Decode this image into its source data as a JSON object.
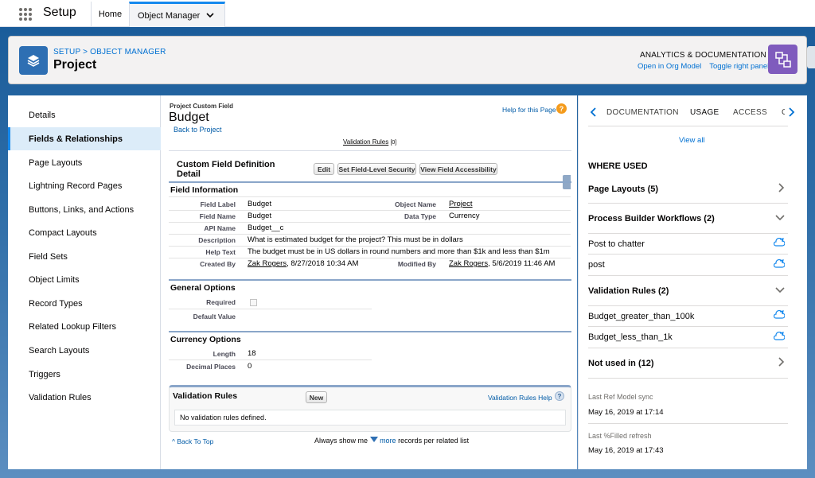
{
  "topbar": {
    "app_name": "Setup",
    "tab_home": "Home",
    "tab_object_manager": "Object Manager"
  },
  "header": {
    "breadcrumb_setup": "SETUP",
    "breadcrumb_sep": " > ",
    "breadcrumb_om": "OBJECT MANAGER",
    "title": "Project",
    "analytics_title": "ANALYTICS & DOCUMENTATION",
    "link_org_model": "Open in Org Model",
    "link_toggle": "Toggle right panel"
  },
  "sidebar": {
    "items": [
      {
        "label": "Details"
      },
      {
        "label": "Fields & Relationships"
      },
      {
        "label": "Page Layouts"
      },
      {
        "label": "Lightning Record Pages"
      },
      {
        "label": "Buttons, Links, and Actions"
      },
      {
        "label": "Compact Layouts"
      },
      {
        "label": "Field Sets"
      },
      {
        "label": "Object Limits"
      },
      {
        "label": "Record Types"
      },
      {
        "label": "Related Lookup Filters"
      },
      {
        "label": "Search Layouts"
      },
      {
        "label": "Triggers"
      },
      {
        "label": "Validation Rules"
      }
    ]
  },
  "main": {
    "subtitle": "Project Custom Field",
    "title": "Budget",
    "back_link": "Back to Project",
    "help_link": "Help for this Page",
    "validation_rules_link": "Validation Rules",
    "validation_rules_count": "[0]",
    "detail_title_1": "Custom Field Definition",
    "detail_title_2": "Detail",
    "btn_edit": "Edit",
    "btn_fls": "Set Field-Level Security",
    "btn_view_access": "View Field Accessibility",
    "field_info_title": "Field Information",
    "fields": {
      "field_label_l": "Field Label",
      "field_label_v": "Budget",
      "object_name_l": "Object Name",
      "object_name_v": "Project",
      "field_name_l": "Field Name",
      "field_name_v": "Budget",
      "data_type_l": "Data Type",
      "data_type_v": "Currency",
      "api_name_l": "API Name",
      "api_name_v": "Budget__c",
      "description_l": "Description",
      "description_v": "What is estimated budget for the project? This must be in dollars",
      "help_text_l": "Help Text",
      "help_text_v": "The budget must be in US dollars in round numbers and more than $1k and less than $1m",
      "created_by_l": "Created By",
      "created_by_user": "Zak Rogers",
      "created_by_date": ", 8/27/2018 10:34 AM",
      "modified_by_l": "Modified By",
      "modified_by_user": "Zak Rogers",
      "modified_by_date": ", 5/6/2019 11:46 AM"
    },
    "general_title": "General Options",
    "required_l": "Required",
    "default_value_l": "Default Value",
    "currency_title": "Currency Options",
    "length_l": "Length",
    "length_v": "18",
    "decimal_l": "Decimal Places",
    "decimal_v": "0",
    "vr_title": "Validation Rules",
    "btn_new": "New",
    "vr_help": "Validation Rules Help",
    "vr_empty": "No validation rules defined.",
    "back_top": "Back To Top",
    "always_show": "Always show me",
    "more": "more",
    "records_per": "records per related list"
  },
  "right": {
    "tabs": [
      "DOCUMENTATION",
      "USAGE",
      "ACCESS",
      "C"
    ],
    "view_all": "View all",
    "where_used": "WHERE USED",
    "page_layouts": "Page Layouts (5)",
    "pbw": "Process Builder Workflows (2)",
    "pbw_items": [
      "Post to chatter",
      "post"
    ],
    "vr": "Validation Rules (2)",
    "vr_items": [
      "Budget_greater_than_100k",
      "Budget_less_than_1k"
    ],
    "not_used": "Not used in (12)",
    "ref_sync_label": "Last Ref Model sync",
    "ref_sync_value": "May 16, 2019 at 17:14",
    "filled_label": "Last %Filled refresh",
    "filled_value": "May 16, 2019 at 17:43"
  },
  "colors": {
    "brand_blue": "#0070d2",
    "active_tab": "#1589ee",
    "object_icon": "#2e6fb3",
    "analytics_icon": "#7f5bbd"
  }
}
